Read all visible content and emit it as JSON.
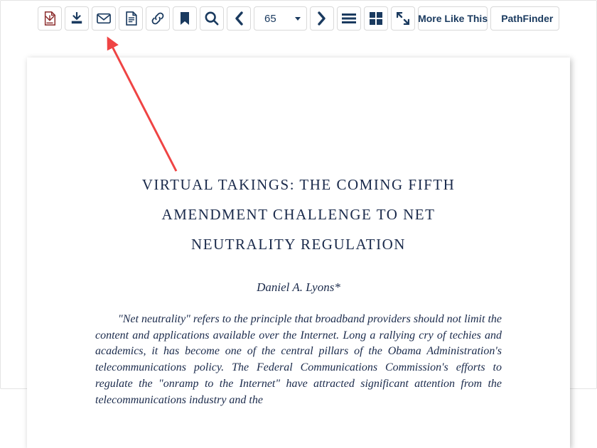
{
  "toolbar": {
    "page_number": "65",
    "more_like_this": "More Like This",
    "pathfinder": "PathFinder"
  },
  "document": {
    "title_line1": "VIRTUAL TAKINGS: THE COMING FIFTH",
    "title_line2": "AMENDMENT CHALLENGE TO NET",
    "title_line3": "NEUTRALITY REGULATION",
    "author": "Daniel A. Lyons*",
    "abstract": "\"Net neutrality\" refers to the principle that broadband providers should not limit the content and applications available over the Internet.  Long a rallying cry of techies and academics, it has become one of the central pillars of the Obama Administration's telecommunications policy.  The Federal Communications Commission's efforts to regulate the \"onramp to the Internet\" have attracted significant attention from the telecommunications industry and the"
  },
  "colors": {
    "primary": "#1a3a5f",
    "pdf_red": "#8a2a2a",
    "arrow_red": "#ef4444"
  }
}
